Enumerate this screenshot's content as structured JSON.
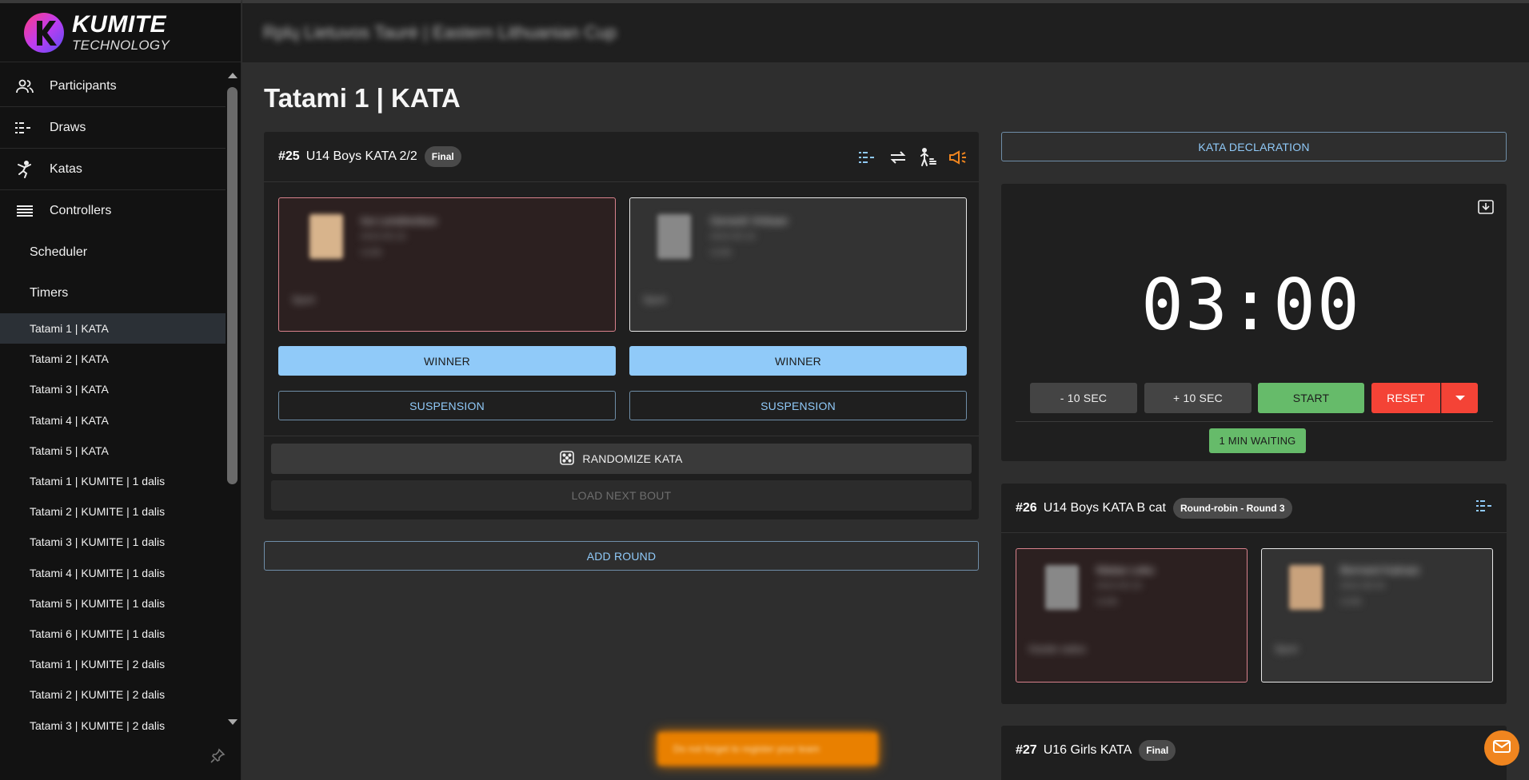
{
  "brand": {
    "line1": "KUMITE",
    "line2": "TECHNOLOGY"
  },
  "topbar": {
    "event_title": "Rplų Lietuvos Taurė | Eastern Lithuanian Cup"
  },
  "sidebar": {
    "main_items": [
      {
        "label": "Participants",
        "icon": "participants-icon"
      },
      {
        "label": "Draws",
        "icon": "draws-icon"
      },
      {
        "label": "Katas",
        "icon": "katas-icon"
      },
      {
        "label": "Controllers",
        "icon": "controllers-icon"
      }
    ],
    "sub_items": [
      "Scheduler",
      "Timers"
    ],
    "tatami_items": [
      "Tatami 1 | KATA",
      "Tatami 2 | KATA",
      "Tatami 3 | KATA",
      "Tatami 4 | KATA",
      "Tatami 5 | KATA",
      "Tatami 1 | KUMITE | 1 dalis",
      "Tatami 2 | KUMITE | 1 dalis",
      "Tatami 3 | KUMITE | 1 dalis",
      "Tatami 4 | KUMITE | 1 dalis",
      "Tatami 5 | KUMITE | 1 dalis",
      "Tatami 6 | KUMITE | 1 dalis",
      "Tatami 1 | KUMITE | 2 dalis",
      "Tatami 2 | KUMITE | 2 dalis",
      "Tatami 3 | KUMITE | 2 dalis"
    ],
    "active_item": "Tatami 1 | KATA"
  },
  "page": {
    "title": "Tatami 1 | KATA"
  },
  "current_bout": {
    "number": "#25",
    "name": "U14 Boys KATA 2/2",
    "badge": "Final",
    "red": {
      "name": "Ivo Lendrenkov",
      "club_line": "2010-05-19",
      "extra": "U14b",
      "footer": "Sport"
    },
    "white": {
      "name": "Gerardi Vinkaer",
      "club_line": "2010-05-19",
      "extra": "U14b",
      "footer": "Sport"
    },
    "winner_label": "WINNER",
    "suspension_label": "SUSPENSION",
    "randomize_label": "RANDOMIZE KATA",
    "load_next_label": "LOAD NEXT BOUT"
  },
  "add_round_label": "ADD ROUND",
  "kata_declaration_label": "KATA DECLARATION",
  "timer": {
    "display": "03:00",
    "minus_label": "- 10 SEC",
    "plus_label": "+ 10 SEC",
    "start_label": "START",
    "reset_label": "RESET",
    "waiting_label": "1 MIN WAITING"
  },
  "next_bout": {
    "number": "#26",
    "name": "U14 Boys KATA B cat",
    "badge": "Round-robin - Round 3",
    "red": {
      "name": "Matas Leko",
      "club_line": "2010-05-19",
      "extra": "U14b",
      "footer": "Karate vadus"
    },
    "white": {
      "name": "Bernard Kalnaiz",
      "club_line": "2011-06-04",
      "extra": "U14b",
      "footer": "Sport"
    }
  },
  "later_bout": {
    "number": "#27",
    "name": "U16 Girls KATA",
    "badge": "Final"
  },
  "banner_text": "Do not forget to register your team",
  "colors": {
    "accent_blue": "#90caf9",
    "start_green": "#66bb6a",
    "reset_red": "#f44336",
    "fab_orange": "#f0851f",
    "red_corner_border": "#d9828c"
  }
}
